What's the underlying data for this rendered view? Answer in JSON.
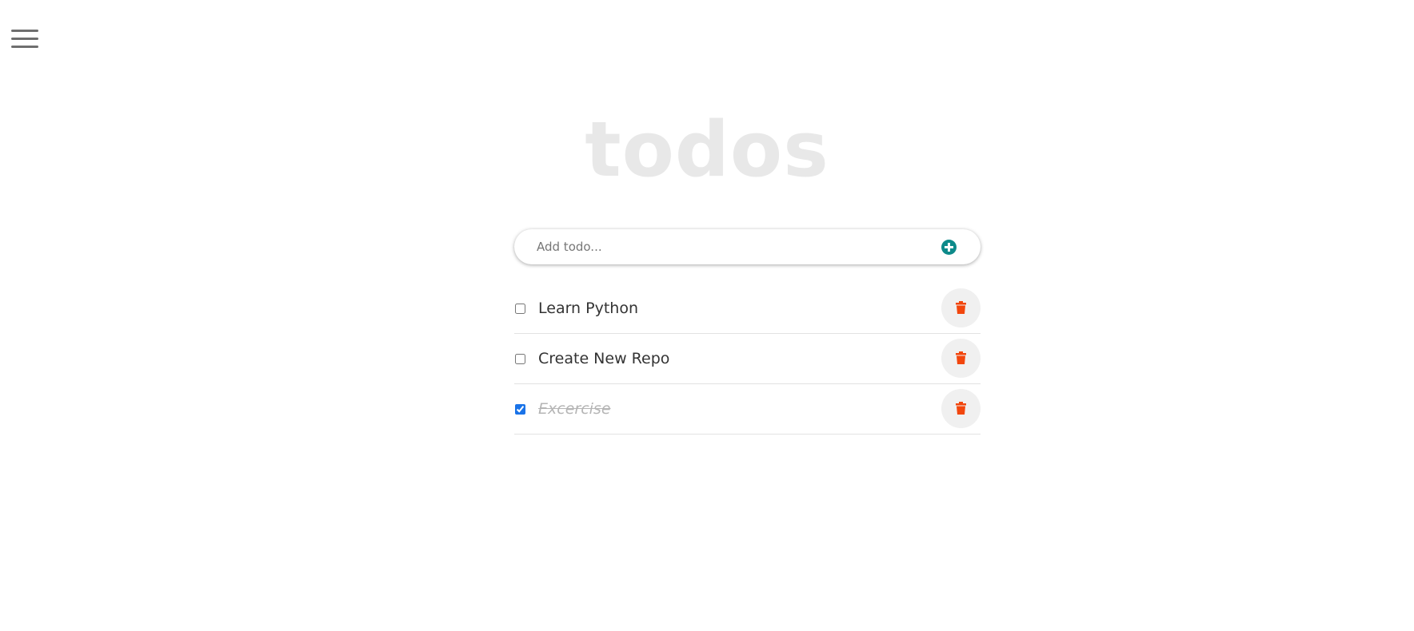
{
  "title": "todos",
  "add_todo": {
    "placeholder": "Add todo...",
    "value": "",
    "add_icon": "plus-circle-icon",
    "add_icon_color": "#0d8a8a"
  },
  "menu_icon": "hamburger-menu-icon",
  "delete_icon": "trash-icon",
  "delete_icon_color": "#f2460d",
  "todos": [
    {
      "text": "Learn Python",
      "completed": false
    },
    {
      "text": "Create New Repo",
      "completed": false
    },
    {
      "text": "Excercise",
      "completed": true
    }
  ]
}
